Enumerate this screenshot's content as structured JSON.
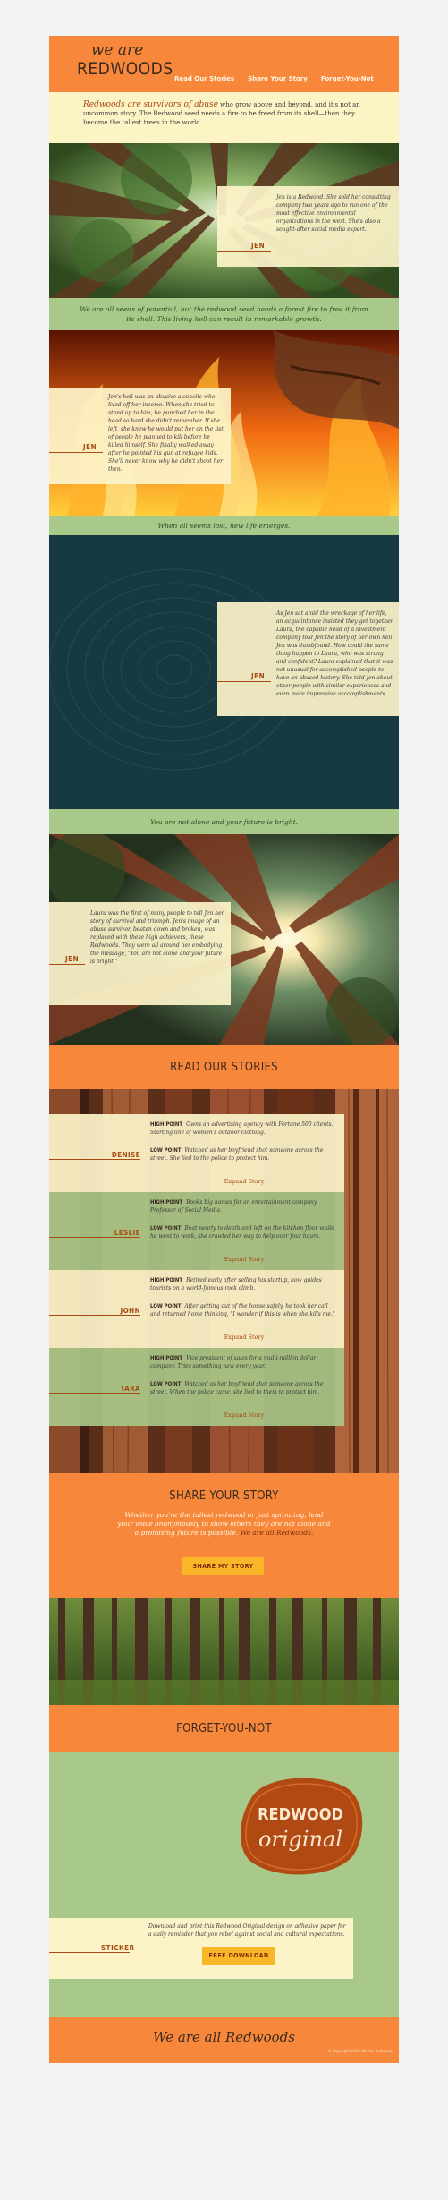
{
  "header": {
    "logo_top": "we are",
    "logo_main": "REDWOODS",
    "nav": [
      "Read Our Stories",
      "Share Your Story",
      "Forget-You-Not"
    ]
  },
  "intro": {
    "lead": "Redwoods are survivors of abuse",
    "rest": " who grow above and beyond, and it's not an uncommon story. The Redwood seed needs a fire to be freed from its shell—then they become the tallest trees in the world."
  },
  "jen_panels": [
    {
      "name": "JEN",
      "text": "Jen is a Redwood. She sold her consulting company two years ago to run one of the most effective environmental organizations in the west. She's also a sought-after social media expert."
    },
    {
      "name": "JEN",
      "text": "Jen's hell was an abusive alcoholic who lived off her income. When she tried to stand up to him, he punched her in the head so hard she didn't remember. If she left, she knew he would put her on the list of people he planned to kill before he killed himself. She finally walked away after he pointed his gun at refugee kids. She'll never know why he didn't shoot her then."
    },
    {
      "name": "JEN",
      "text": "As Jen sat amid the wreckage of her life, an acquaintance insisted they get together. Laura, the capable head of a investment company told Jen the story of her own hell. Jen was dumbfound. How could the same thing happen to Laura, who was strong and confident? Laura explained that it was not unusual for accomplished people to have an abused history. She told Jen about other people with similar experiences and even more impressive accomplishments."
    },
    {
      "name": "JEN",
      "text": "Laura was the first of many people to tell Jen her story of survival and triumph. Jen's image of an abuse survivor, beaten down and broken, was replaced with these high achievers, these Redwoods. They were all around her embodying the message, \"You are not alone and your future is bright.\""
    }
  ],
  "bands": [
    "We are all seeds of potential, but the redwood seed needs a forest fire to free it from its shell. This living hell can result in remarkable growth.",
    "When all seems lost, new life emerges.",
    "You are not alone and your future is bright."
  ],
  "read_stories": {
    "title": "READ OUR STORIES",
    "high_label": "HIGH POINT",
    "low_label": "LOW POINT",
    "expand_label": "Expand Story",
    "items": [
      {
        "name": "DENISE",
        "high": "Owns an advertising agency with Fortune 500 clients. Starting line of women's outdoor clothing.",
        "low": "Watched as her boyfriend shot someone across the street. She lied to the police to protect him."
      },
      {
        "name": "LESLIE",
        "high": "Books big names for an entertainment company. Professor of Social Media.",
        "low": "Beat nearly to death and left on the kitchen floor while he went to work, she crawled her way to help over four hours."
      },
      {
        "name": "JOHN",
        "high": "Retired early after selling his startup, now guides tourists on a world-famous rock climb.",
        "low": "After getting out of the house safely, he took her call and returned home thinking, \"I wonder if this is when she kills me.\""
      },
      {
        "name": "TARA",
        "high": "Vice president of sales for a multi-million dollar company. Tries something new every year.",
        "low": "Watched as her boyfriend shot someone across the street. When the police came, she lied to them to protect him."
      }
    ]
  },
  "share": {
    "title": "SHARE YOUR STORY",
    "text": "Whether you're the tallest redwood or just sprouting, lend your voice anonymously to show others they are not alone and a promising future is possible. ",
    "text_emph": "We are all Redwoods.",
    "button": "SHARE MY STORY"
  },
  "forget": {
    "title": "FORGET-YOU-NOT",
    "badge_line1": "REDWOOD",
    "badge_line2": "original",
    "sticker_label": "STICKER",
    "sticker_text": "Download and print this Redwood Original design on adhesive paper for a daily reminder that you rebel against social and cultural expectations.",
    "button": "FREE DOWNLOAD"
  },
  "footer": {
    "title": "We are all Redwoods",
    "small": "© Copyright 2015 We Are Redwoods"
  }
}
